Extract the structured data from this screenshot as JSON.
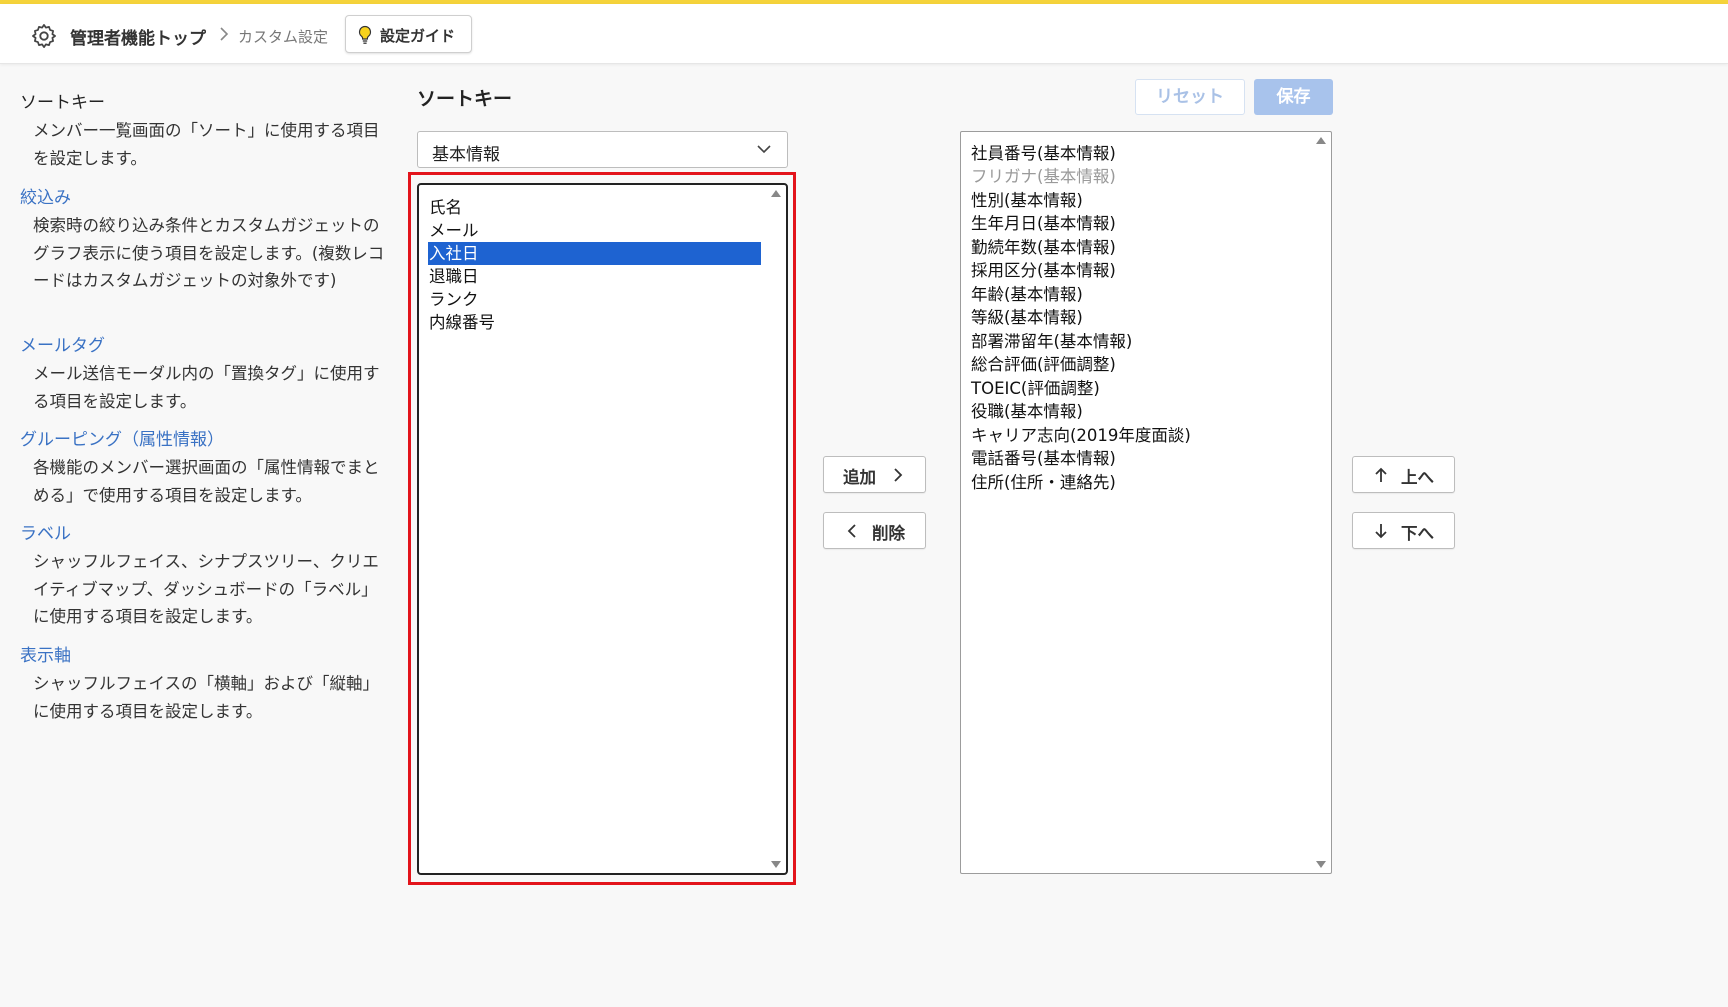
{
  "header": {
    "home_label": "管理者機能トップ",
    "current_label": "カスタム設定",
    "guide_label": "設定ガイド",
    "accent_color": "#f5d33a"
  },
  "help": [
    {
      "title": "ソートキー",
      "desc": "メンバー一覧画面の「ソート」に使用する項目を設定します。",
      "active": true
    },
    {
      "title": "絞込み",
      "desc": "検索時の絞り込み条件とカスタムガジェットのグラフ表示に使う項目を設定します。(複数レコードはカスタムガジェットの対象外です)",
      "active": false
    },
    {
      "title": "メールタグ",
      "desc": "メール送信モーダル内の「置換タグ」に使用する項目を設定します。",
      "active": false
    },
    {
      "title": "グルーピング（属性情報）",
      "desc": "各機能のメンバー選択画面の「属性情報でまとめる」で使用する項目を設定します。",
      "active": false
    },
    {
      "title": "ラベル",
      "desc": "シャッフルフェイス、シナプスツリー、クリエイティブマップ、ダッシュボードの「ラベル」に使用する項目を設定します。",
      "active": false
    },
    {
      "title": "表示軸",
      "desc": "シャッフルフェイスの「横軸」および「縦軸」に使用する項目を設定します。",
      "active": false
    }
  ],
  "main": {
    "heading": "ソートキー",
    "category_select": {
      "value": "基本情報",
      "icon": "chevron-down-icon"
    },
    "available_items": [
      "氏名",
      "メール",
      "入社日",
      "退職日",
      "ランク",
      "内線番号"
    ],
    "selected_available_index": 2,
    "selected_items": [
      "社員番号(基本情報)",
      "フリガナ(基本情報)",
      "性別(基本情報)",
      "生年月日(基本情報)",
      "勤続年数(基本情報)",
      "採用区分(基本情報)",
      "年齢(基本情報)",
      "等級(基本情報)",
      "部署滞留年(基本情報)",
      "総合評価(評価調整)",
      "TOEIC(評価調整)",
      "役職(基本情報)",
      "キャリア志向(2019年度面談)",
      "電話番号(基本情報)",
      "住所(住所・連絡先)"
    ],
    "muted_selected_index": 1,
    "add_label": "追加",
    "remove_label": "削除",
    "up_label": "上へ",
    "down_label": "下へ",
    "reset_label": "リセット",
    "save_label": "保存",
    "highlight_color": "#e3141b",
    "selection_color": "#1e63d1"
  }
}
